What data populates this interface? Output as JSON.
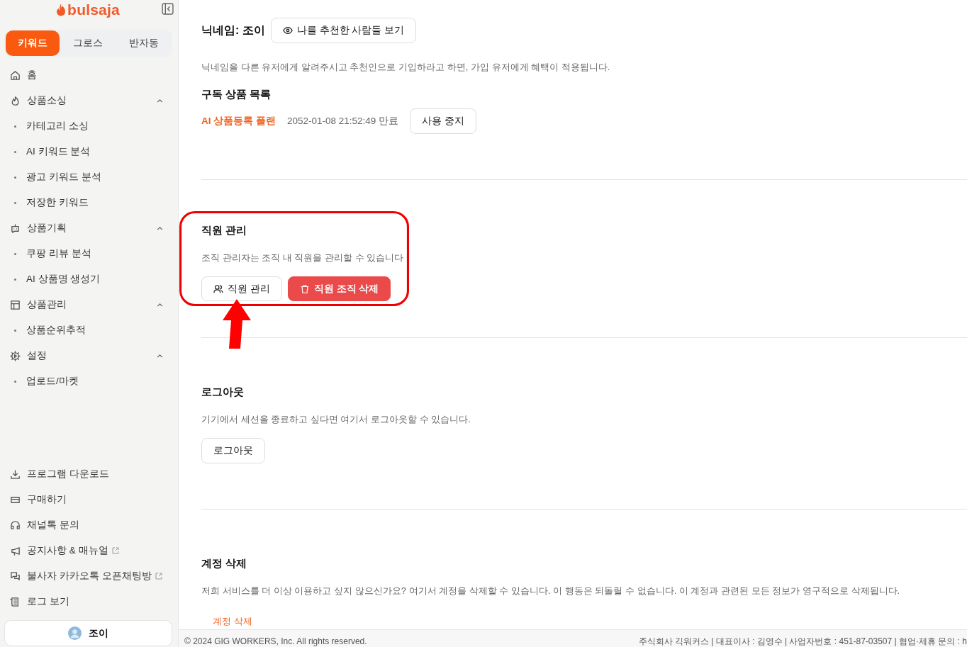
{
  "sidebar": {
    "logo": "bulsaja",
    "tabs": [
      {
        "label": "키워드",
        "selected": true
      },
      {
        "label": "그로스",
        "selected": false
      },
      {
        "label": "반자동",
        "selected": false
      }
    ],
    "menu": [
      {
        "label": "홈"
      },
      {
        "label": "상품소싱",
        "expanded": true,
        "children": [
          {
            "label": "카테고리 소싱"
          },
          {
            "label": "AI 키워드 분석"
          },
          {
            "label": "광고 키워드 분석"
          },
          {
            "label": "저장한 키워드"
          }
        ]
      },
      {
        "label": "상품기획",
        "expanded": true,
        "children": [
          {
            "label": "쿠팡 리뷰 분석"
          },
          {
            "label": "AI 상품명 생성기"
          }
        ]
      },
      {
        "label": "상품관리",
        "expanded": true,
        "children": [
          {
            "label": "상품순위추적"
          }
        ]
      },
      {
        "label": "설정",
        "expanded": true,
        "children": [
          {
            "label": "업로드/마켓"
          }
        ]
      }
    ],
    "bottom_menu": [
      {
        "label": "프로그램 다운로드",
        "external": false
      },
      {
        "label": "구매하기",
        "external": false
      },
      {
        "label": "채널톡 문의",
        "external": false
      },
      {
        "label": "공지사항 & 매뉴얼",
        "external": true
      },
      {
        "label": "불사자 카카오톡 오픈채팅방",
        "external": true
      },
      {
        "label": "로그 보기",
        "external": false
      }
    ],
    "user": "조이"
  },
  "profile": {
    "nickname": "닉네임: 조이",
    "referrers_button": "나를 추천한 사람들 보기",
    "description": "닉네임을 다른 유저에게 알려주시고 추천인으로 기입하라고 하면, 가입 유저에게 혜택이 적용됩니다."
  },
  "subscriptions": {
    "title": "구독 상품 목록",
    "items": [
      {
        "plan": "AI 상품등록 플랜",
        "expires": "2052-01-08 21:52:49 만료",
        "button": "사용 중지"
      }
    ]
  },
  "staff": {
    "title": "직원 관리",
    "description": "조직 관리자는 조직 내 직원을 관리할 수 있습니다",
    "manage_button": "직원 관리",
    "delete_button": "직원 조직 삭제"
  },
  "logout": {
    "title": "로그아웃",
    "description": "기기에서 세션을 종료하고 싶다면 여기서 로그아웃할 수 있습니다.",
    "button": "로그아웃"
  },
  "delete_account": {
    "title": "계정 삭제",
    "description": "저희 서비스를 더 이상 이용하고 싶지 않으신가요? 여기서 계정을 삭제할 수 있습니다. 이 행동은 되돌릴 수 없습니다. 이 계정과 관련된 모든 정보가 영구적으로 삭제됩니다.",
    "button": "계정 삭제"
  },
  "footer": {
    "copyright": "© 2024 GIG WORKERS, Inc. All rights reserved.",
    "company_info": "주식회사 긱워커스 | 대표이사 : 김영수 | 사업자번호 : 451-87-03507 | 협업·제휴 문의 : h"
  }
}
